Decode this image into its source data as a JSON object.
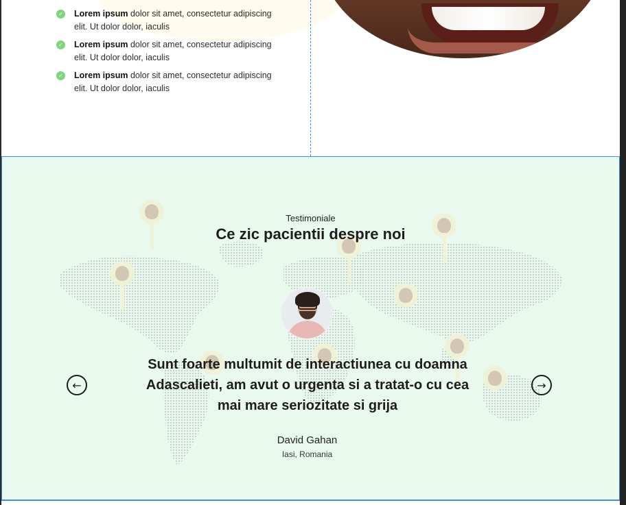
{
  "features": {
    "items": [
      {
        "bold": "Lorem ipsum",
        "text": " dolor sit amet, consectetur adipiscing elit. Ut dolor dolor, iaculis"
      },
      {
        "bold": "Lorem ipsum",
        "text": " dolor sit amet, consectetur adipiscing elit. Ut dolor dolor, iaculis"
      },
      {
        "bold": "Lorem ipsum",
        "text": " dolor sit amet, consectetur adipiscing elit. Ut dolor dolor, iaculis"
      }
    ],
    "check_icon": "check-circle-icon",
    "check_color": "#7fd67a"
  },
  "hero_image": {
    "icon": "smile-photo"
  },
  "testimonials": {
    "eyebrow": "Testimoniale",
    "title": "Ce zic pacientii despre noi",
    "quote": "Sunt foarte multumit de interactiunea cu doamna Adascalieti, am avut o urgenta si a tratat-o cu cea mai mare seriozitate si grija",
    "author_name": "David Gahan",
    "author_location": "Iasi, Romania",
    "prev_icon": "arrow-left-circle-icon",
    "next_icon": "arrow-right-circle-icon",
    "prev_glyph": "←",
    "next_glyph": "→",
    "background_color": "#e9f9ee",
    "accent_color": "#3b8fe0"
  }
}
